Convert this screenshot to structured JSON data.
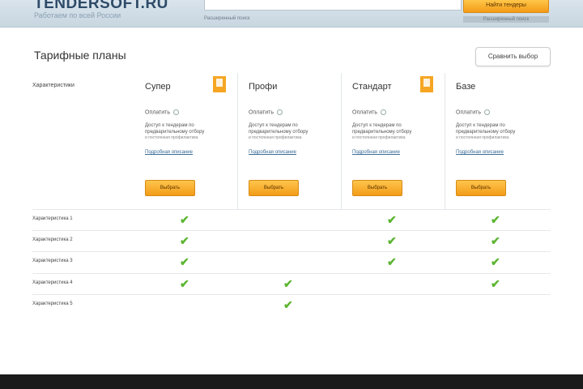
{
  "header": {
    "logo": "TENDERSOFT.RU",
    "tagline": "Работаем по всей России",
    "search_hint": "Расширенный поиск",
    "search_button": "Найти тендеры",
    "advanced_search": "Расширенный поиск"
  },
  "page": {
    "title": "Тарифные планы",
    "compare_button": "Сравнить выбор",
    "char_header": "Характеристики"
  },
  "plans": [
    {
      "name": "Супер",
      "price": "Оплатить",
      "desc": "Доступ к тендерам по предварительному отбору",
      "note": "и постоянная профилактика",
      "more": "Подробная описание",
      "button": "Выбрать",
      "style": "dark",
      "featured": true
    },
    {
      "name": "Профи",
      "price": "Оплатить",
      "desc": "Доступ к тендерам по предварительному отбору",
      "note": "и постоянная профилактика",
      "more": "Подробная описание",
      "button": "Выбрать",
      "style": "light",
      "featured": false
    },
    {
      "name": "Стандарт",
      "price": "Оплатить",
      "desc": "Доступ к тендерам по предварительному отбору",
      "note": "и постоянная профилактика",
      "more": "Подробная описание",
      "button": "Выбрать",
      "style": "light",
      "featured": true
    },
    {
      "name": "Базе",
      "price": "Оплатить",
      "desc": "Доступ к тендерам по предварительному отбору",
      "note": "и постоянная профилактика",
      "more": "Подробная описание",
      "button": "Выбрать",
      "style": "dark",
      "featured": false
    }
  ],
  "features": [
    {
      "label": "Характеристика 1",
      "checks": [
        true,
        false,
        true,
        true
      ]
    },
    {
      "label": "Характеристика 2",
      "checks": [
        true,
        false,
        true,
        true
      ]
    },
    {
      "label": "Характеристика 3",
      "checks": [
        true,
        false,
        true,
        true
      ]
    },
    {
      "label": "Характеристика 4",
      "checks": [
        true,
        true,
        false,
        true
      ]
    },
    {
      "label": "Характеристика 5",
      "checks": [
        false,
        true,
        false,
        false
      ]
    }
  ],
  "check_icon": "check-mark-icon",
  "colors": {
    "accent": "#f6a623",
    "header_dark": "#52748f",
    "header_light": "#dfe6ec",
    "check": "#5cb531"
  }
}
